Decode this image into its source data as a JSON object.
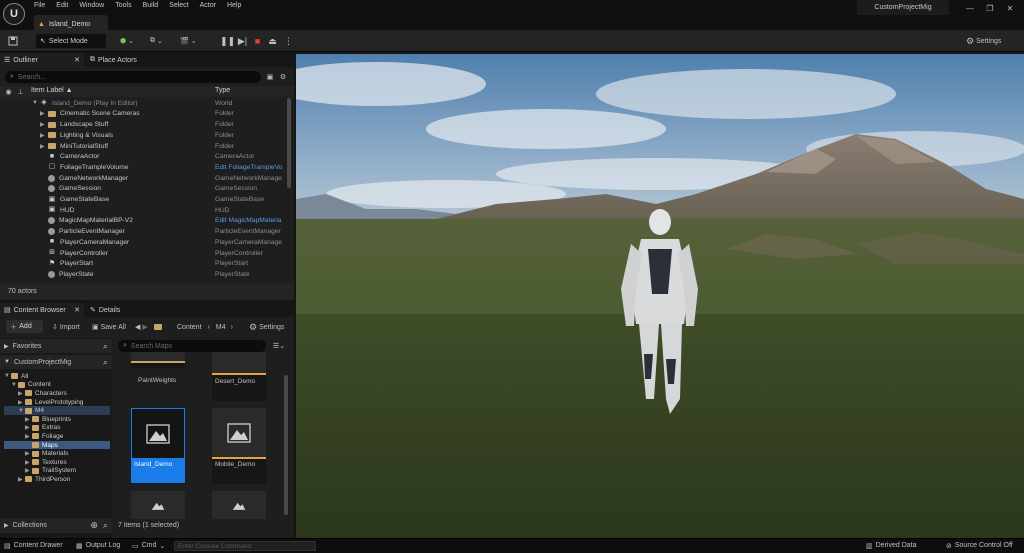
{
  "app": {
    "logo_text": "U",
    "menu": [
      "File",
      "Edit",
      "Window",
      "Tools",
      "Build",
      "Select",
      "Actor",
      "Help"
    ],
    "level_tab": "Island_Demo",
    "project_name": "CustomProjectMig",
    "window_buttons": [
      "—",
      "❐",
      "✕"
    ]
  },
  "toolbar": {
    "select_mode": "Select Mode",
    "settings_label": "Settings"
  },
  "outliner": {
    "tab_outliner": "Outliner",
    "tab_place_actors": "Place Actors",
    "search_placeholder": "Search...",
    "col_item_label": "Item Label ▲",
    "col_type": "Type",
    "rows": [
      {
        "label": "Island_Demo (Play In Editor)",
        "type": "World",
        "kind": "world",
        "indent": 0,
        "arrow": "▼"
      },
      {
        "label": "Cinematic Scene Cameras",
        "type": "Folder",
        "kind": "folder",
        "indent": 1,
        "arrow": "▶"
      },
      {
        "label": "Landscape Stuff",
        "type": "Folder",
        "kind": "folder",
        "indent": 1,
        "arrow": "▶"
      },
      {
        "label": "Lighting & Visuals",
        "type": "Folder",
        "kind": "folder",
        "indent": 1,
        "arrow": "▶"
      },
      {
        "label": "MiniTutorialStuff",
        "type": "Folder",
        "kind": "folder",
        "indent": 1,
        "arrow": "▶"
      },
      {
        "label": "CameraActor",
        "type": "CameraActor",
        "kind": "camera",
        "indent": 1,
        "arrow": ""
      },
      {
        "label": "FoliageTrampleVolume",
        "type": "Edit FoliageTrampleVo",
        "kind": "volume",
        "indent": 1,
        "arrow": "",
        "link": true
      },
      {
        "label": "GameNetworkManager",
        "type": "GameNetworkManage",
        "kind": "round",
        "indent": 1,
        "arrow": ""
      },
      {
        "label": "GameSession",
        "type": "GameSession",
        "kind": "round",
        "indent": 1,
        "arrow": ""
      },
      {
        "label": "GameStateBase",
        "type": "GameStateBase",
        "kind": "box",
        "indent": 1,
        "arrow": ""
      },
      {
        "label": "HUD",
        "type": "HUD",
        "kind": "box",
        "indent": 1,
        "arrow": ""
      },
      {
        "label": "MagicMapMaterialBP-V2",
        "type": "Edit MagicMapMateria",
        "kind": "round",
        "indent": 1,
        "arrow": "",
        "link": true
      },
      {
        "label": "ParticleEventManager",
        "type": "ParticleEventManager",
        "kind": "round",
        "indent": 1,
        "arrow": ""
      },
      {
        "label": "PlayerCameraManager",
        "type": "PlayerCameraManage",
        "kind": "camera",
        "indent": 1,
        "arrow": ""
      },
      {
        "label": "PlayerController",
        "type": "PlayerController",
        "kind": "gamepad",
        "indent": 1,
        "arrow": ""
      },
      {
        "label": "PlayerStart",
        "type": "PlayerStart",
        "kind": "flag",
        "indent": 1,
        "arrow": ""
      },
      {
        "label": "PlayerState",
        "type": "PlayerState",
        "kind": "round",
        "indent": 1,
        "arrow": ""
      }
    ],
    "actor_count": "70 actors"
  },
  "content_browser": {
    "tab_content_browser": "Content Browser",
    "tab_details": "Details",
    "add_label": "Add",
    "import_label": "Import",
    "save_all_label": "Save All",
    "breadcrumb": [
      "Content",
      "M4"
    ],
    "settings_label": "Settings",
    "favorites_label": "Favorites",
    "project_label": "CustomProjectMig",
    "search_placeholder": "Search Maps",
    "tree": [
      {
        "label": "All",
        "indent": 0,
        "arrow": "▼"
      },
      {
        "label": "Content",
        "indent": 1,
        "arrow": "▼"
      },
      {
        "label": "Characters",
        "indent": 2,
        "arrow": "▶"
      },
      {
        "label": "LevelPrototyping",
        "indent": 2,
        "arrow": "▶"
      },
      {
        "label": "M4",
        "indent": 2,
        "arrow": "▼",
        "state": "hover"
      },
      {
        "label": "Blueprints",
        "indent": 3,
        "arrow": "▶"
      },
      {
        "label": "Extras",
        "indent": 3,
        "arrow": "▶"
      },
      {
        "label": "Foliage",
        "indent": 3,
        "arrow": "▶"
      },
      {
        "label": "Maps",
        "indent": 3,
        "arrow": "",
        "state": "sel"
      },
      {
        "label": "Materials",
        "indent": 3,
        "arrow": "▶"
      },
      {
        "label": "Textures",
        "indent": 3,
        "arrow": "▶"
      },
      {
        "label": "TrailSystem",
        "indent": 3,
        "arrow": "▶"
      },
      {
        "label": "ThirdPerson",
        "indent": 2,
        "arrow": "▶"
      }
    ],
    "assets": [
      "PaintWeights",
      "Desert_Demo",
      "Island_Demo",
      "Mobile_Demo"
    ],
    "collections_label": "Collections",
    "item_count": "7 items (1 selected)"
  },
  "statusbar": {
    "content_drawer": "Content Drawer",
    "output_log": "Output Log",
    "cmd": "Cmd",
    "console_placeholder": "Enter Console Command",
    "derived_data": "Derived Data",
    "source_control": "Source Control Off"
  },
  "colors": {
    "accent_blue": "#1a7ce8",
    "folder_yellow": "#c9a56b",
    "stop_red": "#e0413a"
  }
}
